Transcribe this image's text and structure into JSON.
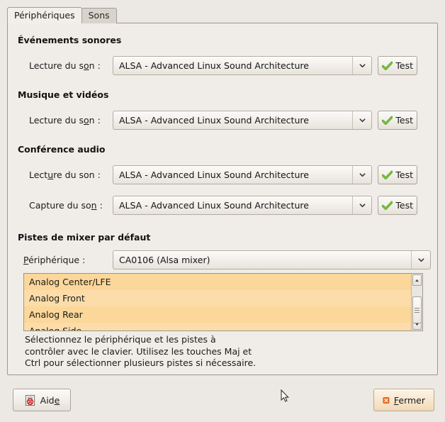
{
  "window": {
    "bg_color": "#ece9e4",
    "frame_color": "#f0ede8"
  },
  "tabs": [
    {
      "label": "Périphériques",
      "active": true
    },
    {
      "label": "Sons",
      "active": false
    }
  ],
  "sections": [
    {
      "title": "Événements sonores",
      "fields": [
        {
          "label_pre": "Lecture du s",
          "label_mn": "o",
          "label_post": "n :",
          "value": "ALSA - Advanced Linux Sound Architecture",
          "test_label": "Test"
        }
      ]
    },
    {
      "title": "Musique et vidéos",
      "fields": [
        {
          "label_pre": "Lecture du s",
          "label_mn": "o",
          "label_post": "n :",
          "value": "ALSA - Advanced Linux Sound Architecture",
          "test_label": "Test"
        }
      ]
    },
    {
      "title": "Conférence audio",
      "fields": [
        {
          "label_pre": "Lect",
          "label_mn": "u",
          "label_post": "re du son :",
          "value": "ALSA - Advanced Linux Sound Architecture",
          "test_label": "Test"
        },
        {
          "label_pre": "Capture du so",
          "label_mn": "n",
          "label_post": " :",
          "value": "ALSA - Advanced Linux Sound Architecture",
          "test_label": "Test"
        }
      ]
    }
  ],
  "mixer": {
    "title": "Pistes de mixer par défaut",
    "device_label_pre": "",
    "device_label_mn": "P",
    "device_label_post": "ériphérique :",
    "device_value": "CA0106 (Alsa mixer)",
    "tracks": [
      "Analog Center/LFE",
      "Analog Front",
      "Analog Rear",
      "Analog Side"
    ],
    "selection_color": "#fbd79a",
    "hint": "Sélectionnez le périphérique et les pistes à\ncontrôler avec le clavier. Utilisez les touches Maj et\nCtrl pour sélectionner plusieurs pistes si nécessaire."
  },
  "footer": {
    "help_pre": "Aid",
    "help_mn": "e",
    "help_post": "",
    "close_pre": "",
    "close_mn": "F",
    "close_post": "ermer",
    "help_icon": "help-document-icon",
    "close_icon": "close-x-icon",
    "close_icon_color": "#f07020"
  },
  "icons": {
    "test": "green-check-icon",
    "combo": "chevron-down-icon",
    "scroll_up": "scroll-up-arrow-icon",
    "scroll_down": "scroll-down-arrow-icon"
  }
}
